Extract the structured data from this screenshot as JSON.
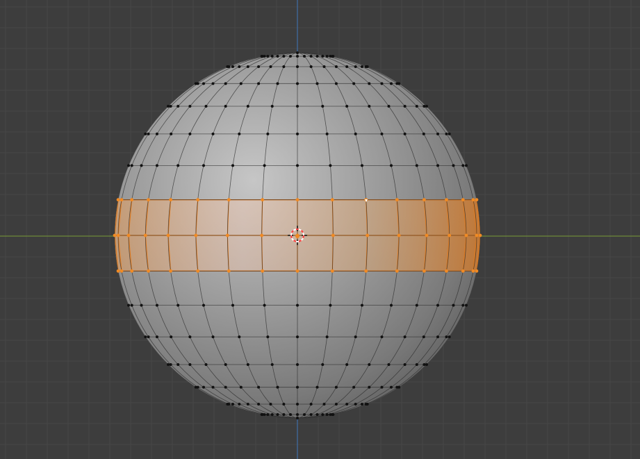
{
  "viewport": {
    "background_color": "#3d3d3d",
    "grid_minor_color": "#474747",
    "grid_major_color": "#505050",
    "x_axis_color": "#6e8a3a",
    "z_axis_color": "#3f6ea8"
  },
  "mesh": {
    "object_type": "uv-sphere",
    "segments": 32,
    "rings": 16,
    "selected_loop": "equator-face-ring",
    "vertex_color": "#111111",
    "edge_color": "#2a2a2a",
    "selected_vertex_color": "#f08a24",
    "selected_edge_color": "#e07a1e",
    "selected_face_tint": "#e8a05e"
  },
  "cursor": {
    "icon": "3d-cursor-icon",
    "ring_color_a": "#ff4040",
    "ring_color_b": "#ffffff"
  },
  "origin": {
    "icon": "object-origin-icon",
    "color": "#f08a24"
  }
}
